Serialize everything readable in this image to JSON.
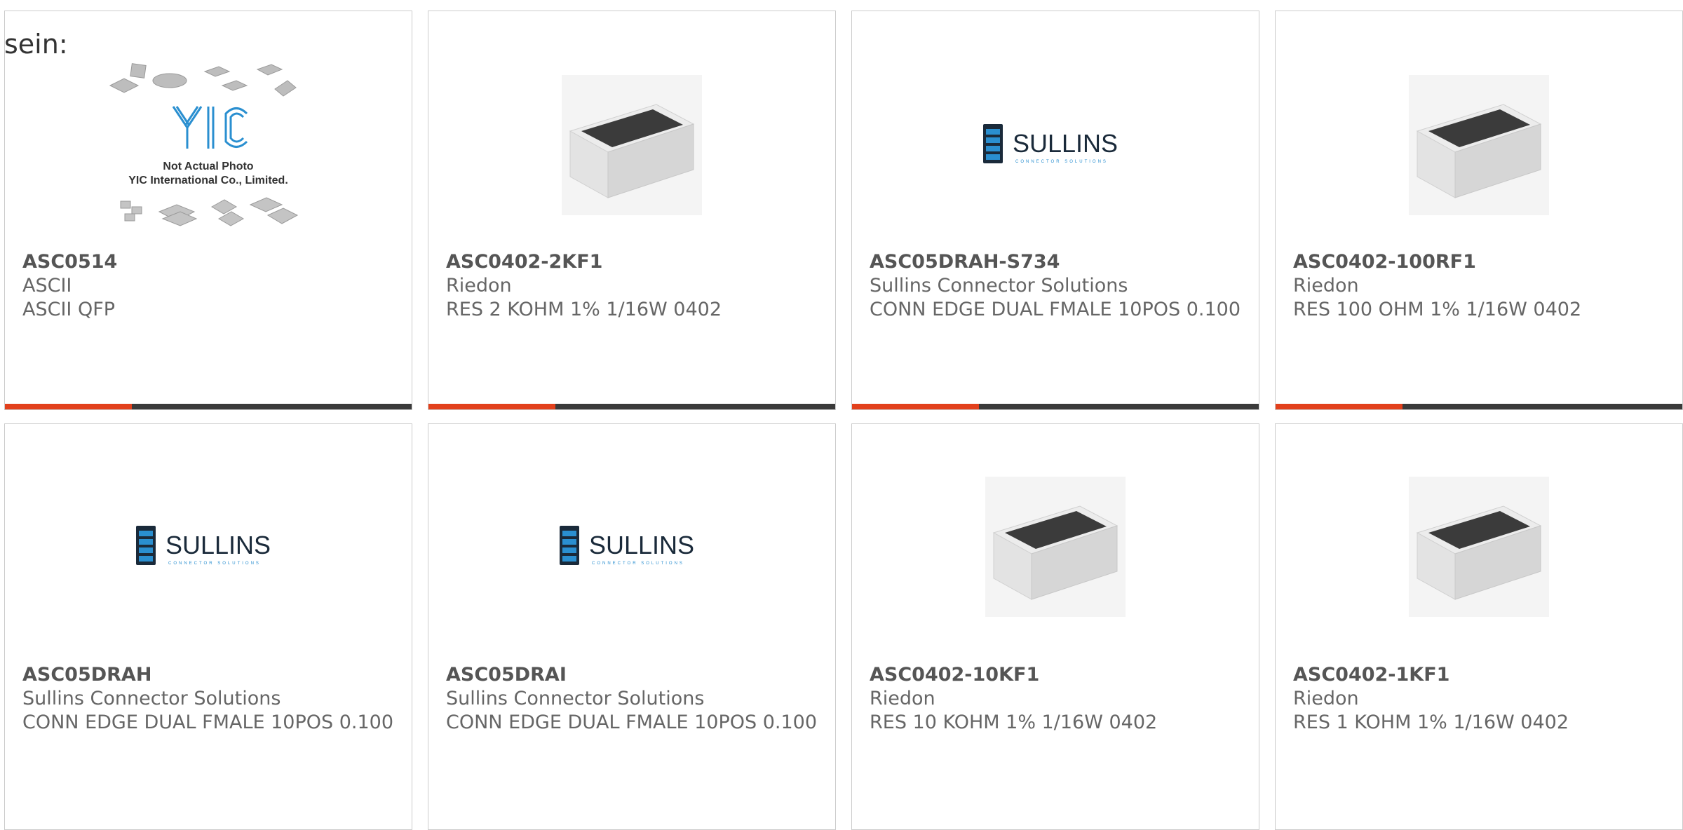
{
  "heading": "sein:",
  "colors": {
    "accent": "#e2401c",
    "bar": "#3a3a3a",
    "text": "#666666",
    "border": "#cccccc"
  },
  "products": [
    {
      "part_number": "ASC0514",
      "manufacturer": "ASCII",
      "description": "ASCII QFP",
      "image": "yic-placeholder-image",
      "image_text_1": "Not Actual Photo",
      "image_text_2": "YIC International Co., Limited.",
      "image_logo": "YIC"
    },
    {
      "part_number": "ASC0402-2KF1",
      "manufacturer": "Riedon",
      "description": "RES 2 KOHM 1% 1/16W 0402",
      "image": "chip-resistor-image"
    },
    {
      "part_number": "ASC05DRAH-S734",
      "manufacturer": "Sullins Connector Solutions",
      "description": "CONN EDGE DUAL FMALE 10POS 0.100",
      "image": "sullins-logo-image",
      "logo_text": "SULLINS",
      "logo_sub": "CONNECTOR SOLUTIONS"
    },
    {
      "part_number": "ASC0402-100RF1",
      "manufacturer": "Riedon",
      "description": "RES 100 OHM 1% 1/16W 0402",
      "image": "chip-resistor-image"
    },
    {
      "part_number": "ASC05DRAH",
      "manufacturer": "Sullins Connector Solutions",
      "description": "CONN EDGE DUAL FMALE 10POS 0.100",
      "image": "sullins-logo-image",
      "logo_text": "SULLINS",
      "logo_sub": "CONNECTOR SOLUTIONS"
    },
    {
      "part_number": "ASC05DRAI",
      "manufacturer": "Sullins Connector Solutions",
      "description": "CONN EDGE DUAL FMALE 10POS 0.100",
      "image": "sullins-logo-image",
      "logo_text": "SULLINS",
      "logo_sub": "CONNECTOR SOLUTIONS"
    },
    {
      "part_number": "ASC0402-10KF1",
      "manufacturer": "Riedon",
      "description": "RES 10 KOHM 1% 1/16W 0402",
      "image": "chip-resistor-image"
    },
    {
      "part_number": "ASC0402-1KF1",
      "manufacturer": "Riedon",
      "description": "RES 1 KOHM 1% 1/16W 0402",
      "image": "chip-resistor-image"
    }
  ]
}
